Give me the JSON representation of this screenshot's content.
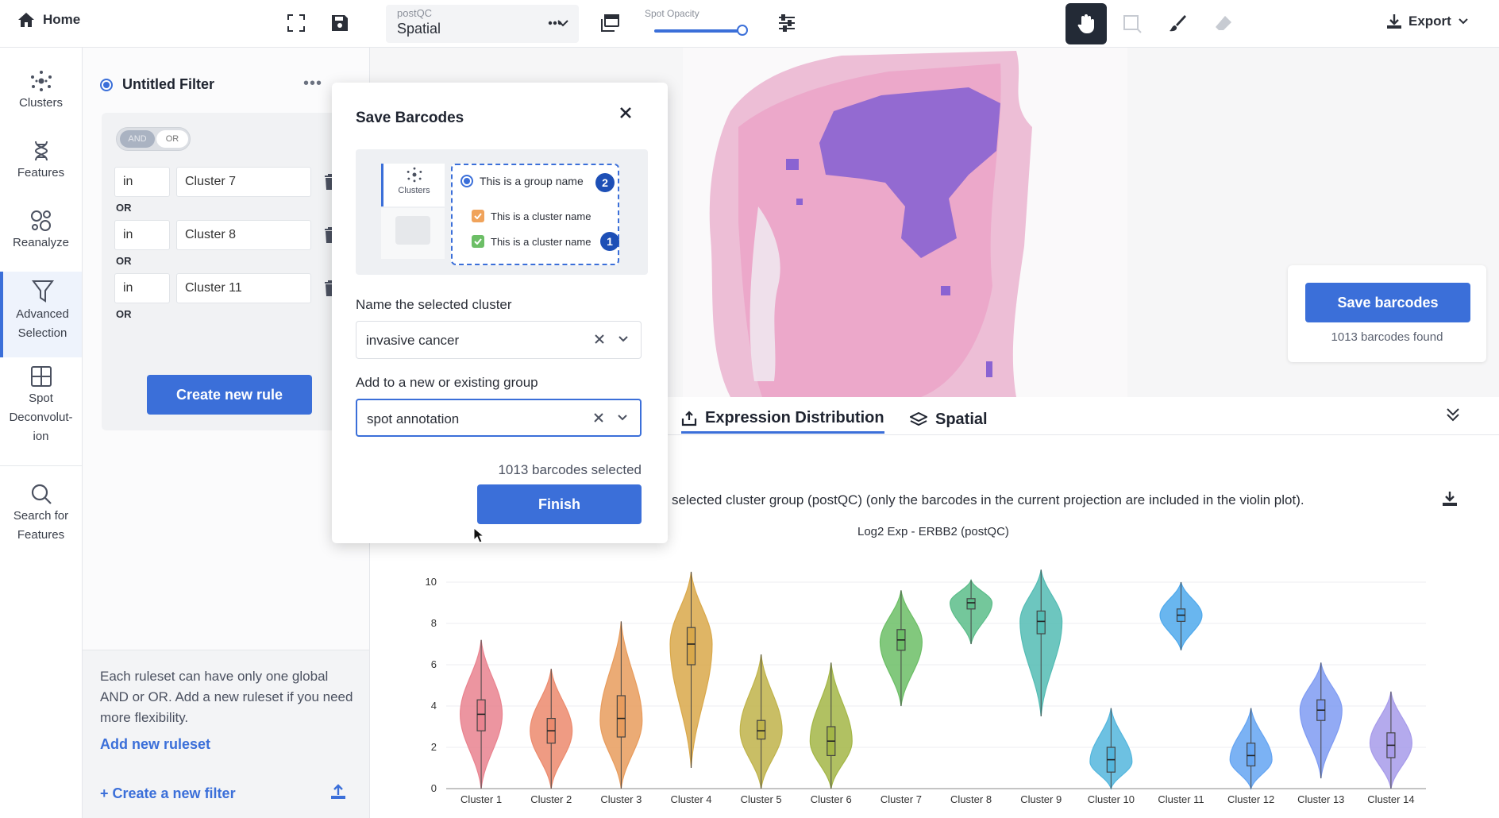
{
  "topbar": {
    "home_label": "Home",
    "projection_label": "postQC",
    "projection_value": "Spatial",
    "opacity_label": "Spot Opacity",
    "opacity_value": 0.95,
    "export_label": "Export"
  },
  "rail": {
    "items": [
      {
        "label": "Clusters",
        "icon": "clusters-icon"
      },
      {
        "label": "Features",
        "icon": "dna-icon"
      },
      {
        "label": "Reanalyze",
        "icon": "reanalyze-icon"
      },
      {
        "label": "Advanced Selection",
        "icon": "filter-icon"
      },
      {
        "label": "Spot Deconvolut-ion",
        "icon": "grid-icon"
      },
      {
        "label": "Search for Features",
        "icon": "search-icon"
      }
    ]
  },
  "filter": {
    "title": "Untitled Filter",
    "toggle_and": "AND",
    "toggle_or": "OR",
    "rules": [
      {
        "op": "in",
        "value": "Cluster 7"
      },
      {
        "op": "in",
        "value": "Cluster 8"
      },
      {
        "op": "in",
        "value": "Cluster 11"
      }
    ],
    "or_label": "OR",
    "create_rule_label": "Create new rule",
    "info_text": "Each ruleset can have only one global AND or OR. Add a new ruleset if you need more flexibility.",
    "add_ruleset_label": "Add new ruleset",
    "create_filter_label": "+ Create a new filter"
  },
  "save_card": {
    "button_label": "Save barcodes",
    "count_text": "1013 barcodes found"
  },
  "tabs": [
    {
      "label": "Expression Distribution",
      "active": true
    },
    {
      "label": "Spatial",
      "active": false
    }
  ],
  "plot": {
    "caption": "selected cluster group (postQC) (only the barcodes in the current projection are included in the violin plot)."
  },
  "modal": {
    "title": "Save Barcodes",
    "illus_clusters": "Clusters",
    "illus_group": "This is a group name",
    "illus_cluster_a": "This is a cluster name",
    "illus_cluster_b": "This is a cluster name",
    "badge_1": "1",
    "badge_2": "2",
    "name_label": "Name the selected cluster",
    "name_value": "invasive cancer",
    "group_label": "Add to a new or existing group",
    "group_value": "spot annotation",
    "selected_count": "1013 barcodes selected",
    "finish_label": "Finish"
  },
  "colors": {
    "accent": "#3b6fd9",
    "dark_tool": "#232a36",
    "selection_purple": "#8a63d2",
    "tissue_pink": "#e8a9c9"
  },
  "chart_data": {
    "type": "violin",
    "title": "Log2 Exp - ERBB2 (postQC)",
    "categories": [
      "Cluster 1",
      "Cluster 2",
      "Cluster 3",
      "Cluster 4",
      "Cluster 5",
      "Cluster 6",
      "Cluster 7",
      "Cluster 8",
      "Cluster 9",
      "Cluster 10",
      "Cluster 11",
      "Cluster 12",
      "Cluster 13",
      "Cluster 14"
    ],
    "colors": [
      "#e9838f",
      "#ec8a6d",
      "#e89c5d",
      "#d9a84a",
      "#bfb34a",
      "#a3b646",
      "#6cbe66",
      "#5cbd8a",
      "#54bcb4",
      "#53b6dd",
      "#4fa9ec",
      "#64a4f2",
      "#7f9bf2",
      "#a79bea"
    ],
    "min": [
      0,
      0,
      0,
      1,
      0,
      0,
      4,
      7,
      3.5,
      0,
      6.7,
      0,
      0.5,
      0
    ],
    "q1": [
      2.8,
      2.2,
      2.5,
      6,
      2.4,
      1.6,
      6.7,
      8.7,
      7.5,
      0.8,
      8.1,
      1.1,
      3.3,
      1.5
    ],
    "median": [
      3.6,
      2.8,
      3.4,
      7,
      2.8,
      2.3,
      7.2,
      9,
      8.1,
      1.4,
      8.4,
      1.6,
      3.8,
      2.1
    ],
    "q3": [
      4.3,
      3.4,
      4.5,
      7.8,
      3.3,
      3.0,
      7.7,
      9.2,
      8.6,
      2.0,
      8.7,
      2.2,
      4.3,
      2.7
    ],
    "max": [
      7.2,
      5.8,
      8.1,
      10.5,
      6.5,
      6.1,
      9.6,
      10.1,
      10.6,
      3.9,
      10,
      3.9,
      6.1,
      4.7
    ],
    "peak": [
      3.6,
      2.8,
      3.3,
      7,
      2.8,
      2.3,
      7.1,
      9,
      8.1,
      1.3,
      8.4,
      1.4,
      3.8,
      2.2
    ],
    "ylim": [
      0,
      10.5
    ],
    "yticks": [
      0,
      2,
      4,
      6,
      8,
      10
    ]
  }
}
